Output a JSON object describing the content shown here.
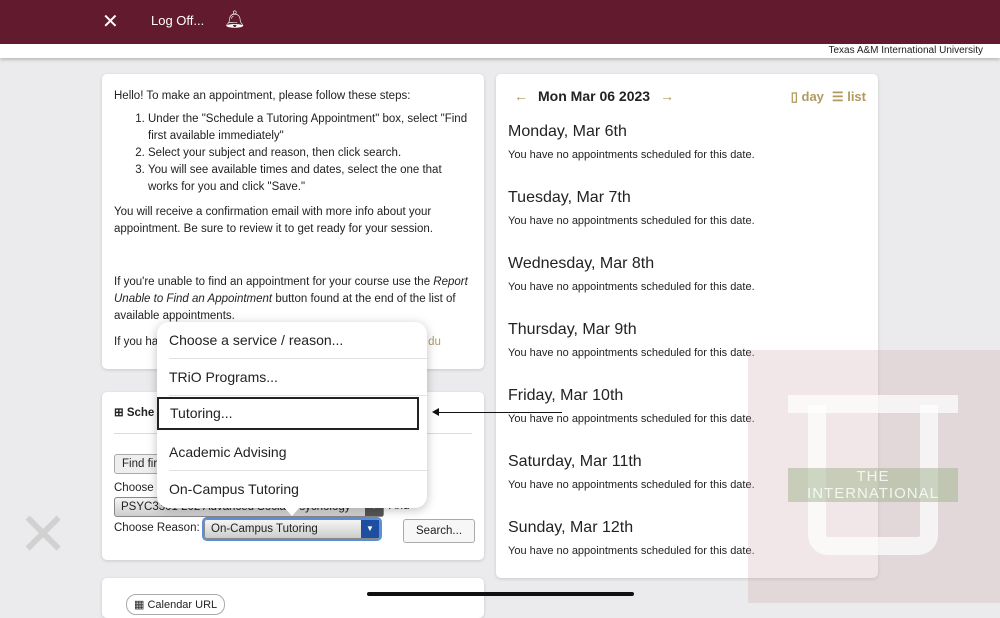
{
  "topbar": {
    "logoff": "Log Off...",
    "university": "Texas A&M International University",
    "logo_icon": "logo-icon",
    "bell_icon": "bell-icon",
    "color": "#611a2e"
  },
  "instructions": {
    "intro": "Hello! To make an appointment, please follow these steps:",
    "steps": [
      "Under the \"Schedule a Tutoring Appointment\" box, select \"Find first available immediately\"",
      "Select your subject and reason, then click search.",
      "You will see available times and dates, select the one that works for you and click \"Save.\""
    ],
    "confirm": "You will receive a confirmation email with more info about your appointment. Be sure to review it to get ready for your session.",
    "unable_pre": "If you're unable to find an appointment for your course use the ",
    "unable_em": "Report Unable to Find an Appointment",
    "unable_post": " button found at the end of the list of available appointments.",
    "if_you": "If you ha",
    "email_tail": "du"
  },
  "schedule": {
    "title": "Sche",
    "find_button": "Find fir",
    "choose_label": "Choose",
    "course_value": "PSYC3301 202 Advanced Social Psychology",
    "and_label": "And",
    "reason_label": "Choose Reason:",
    "reason_value": "On-Campus Tutoring",
    "search_button": "Search..."
  },
  "calendar_url": "Calendar URL",
  "popup": {
    "items": [
      "Choose a service / reason...",
      "TRiO Programs...",
      "Tutoring...",
      "Academic Advising",
      "On-Campus Tutoring"
    ],
    "highlighted": "Tutoring..."
  },
  "calendar": {
    "date": "Mon Mar 06 2023",
    "day_view": "day",
    "list_view": "list",
    "accent": "#b19a5e",
    "days": [
      {
        "title": "Monday, Mar 6th",
        "msg": "You have no appointments scheduled for this date."
      },
      {
        "title": "Tuesday, Mar 7th",
        "msg": "You have no appointments scheduled for this date."
      },
      {
        "title": "Wednesday, Mar 8th",
        "msg": "You have no appointments scheduled for this date."
      },
      {
        "title": "Thursday, Mar 9th",
        "msg": "You have no appointments scheduled for this date."
      },
      {
        "title": "Friday, Mar 10th",
        "msg": "You have no appointments scheduled for this date."
      },
      {
        "title": "Saturday, Mar 11th",
        "msg": "You have no appointments scheduled for this date."
      },
      {
        "title": "Sunday, Mar 12th",
        "msg": "You have no appointments scheduled for this date."
      }
    ]
  },
  "watermark": {
    "text": "THE INTERNATIONAL"
  }
}
